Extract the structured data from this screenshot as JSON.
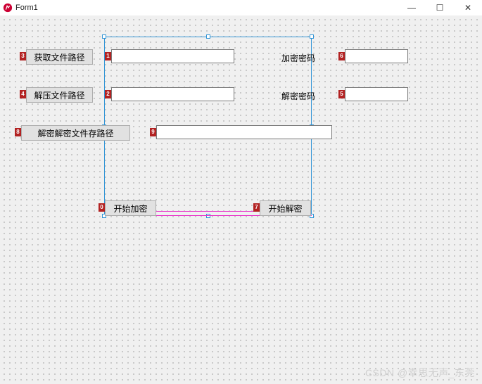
{
  "window": {
    "title": "Form1"
  },
  "winControls": {
    "min": "—",
    "max": "☐",
    "close": "✕"
  },
  "tags": {
    "btn1": "3",
    "txt1": "1",
    "lblEncPwd": "",
    "txtEncPwd": "6",
    "btn2": "4",
    "txt2": "2",
    "lblDecPwd": "",
    "txtDecPwd": "5",
    "btn3": "8",
    "txt3": "9",
    "btnEnc": "0",
    "btnDec": "7"
  },
  "controls": {
    "btn1_label": "获取文件路径",
    "btn2_label": "解压文件路径",
    "btn3_label": "解密解密文件存路径",
    "label_enc_pwd": "加密密码",
    "label_dec_pwd": "解密密码",
    "btn_encrypt_label": "开始加密",
    "btn_decrypt_label": "开始解密",
    "txt1_val": "",
    "txt2_val": "",
    "txt3_val": "",
    "txt_enc_pwd_val": "",
    "txt_dec_pwd_val": ""
  },
  "watermark": "CSDN @幸思无声_东莞"
}
